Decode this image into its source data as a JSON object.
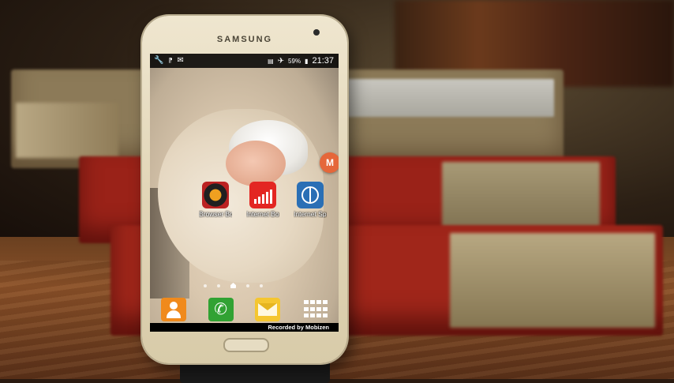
{
  "phone": {
    "brand": "SAMSUNG"
  },
  "status_bar": {
    "left_icons": [
      "wrench-icon",
      "bluetooth-icon",
      "chat-icon"
    ],
    "right_icons": [
      "signal-icon",
      "airplane-icon"
    ],
    "battery": "59%",
    "time": "21:37"
  },
  "floating_icon": {
    "label": "M"
  },
  "home_apps": [
    {
      "name": "Browser Booster",
      "label": "Browser Booster"
    },
    {
      "name": "Internet Booster &",
      "label": "Internet Booster &"
    },
    {
      "name": "Internet Speed",
      "label": "Internet Speed..."
    }
  ],
  "dock": [
    {
      "name": "contacts-icon"
    },
    {
      "name": "phone-icon",
      "glyph": "✆"
    },
    {
      "name": "messages-icon"
    },
    {
      "name": "apps-grid-icon"
    }
  ],
  "recorder_watermark": "Recorded by Mobizen",
  "colors": {
    "contacts": "#f08a1c",
    "phone": "#31a233",
    "messages": "#f5c630",
    "internet_booster": "#e32622",
    "internet_speed": "#2a6fb5"
  }
}
